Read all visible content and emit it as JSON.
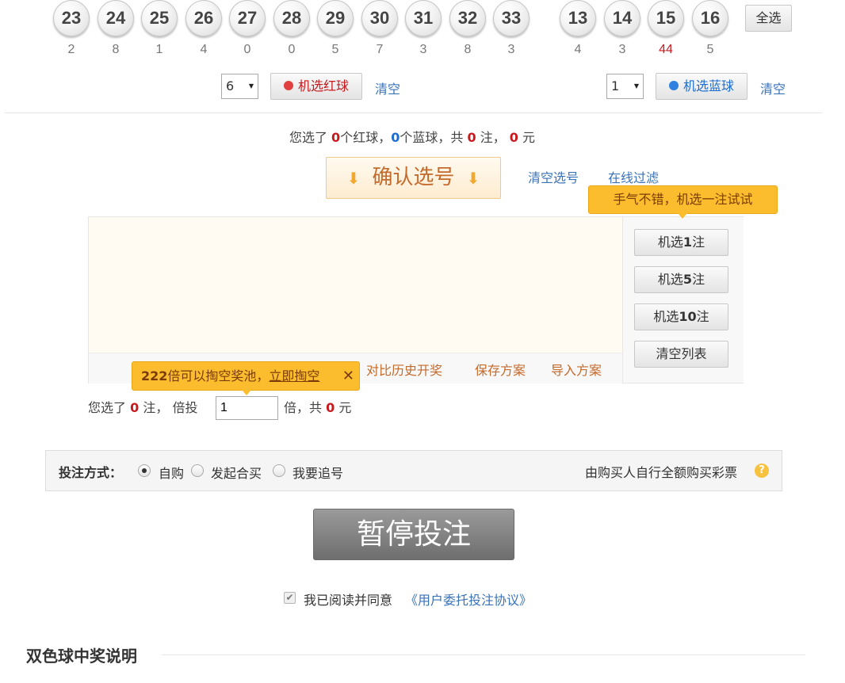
{
  "red_balls": [
    {
      "number": "23",
      "count": "2"
    },
    {
      "number": "24",
      "count": "8"
    },
    {
      "number": "25",
      "count": "1"
    },
    {
      "number": "26",
      "count": "4"
    },
    {
      "number": "27",
      "count": "0"
    },
    {
      "number": "28",
      "count": "0"
    },
    {
      "number": "29",
      "count": "5"
    },
    {
      "number": "30",
      "count": "7"
    },
    {
      "number": "31",
      "count": "3"
    },
    {
      "number": "32",
      "count": "8"
    },
    {
      "number": "33",
      "count": "3"
    }
  ],
  "blue_balls": [
    {
      "number": "13",
      "count": "4"
    },
    {
      "number": "14",
      "count": "3"
    },
    {
      "number": "15",
      "count": "44",
      "hot": true
    },
    {
      "number": "16",
      "count": "5"
    }
  ],
  "select_all_label": "全选",
  "red_random": {
    "count": "6",
    "button_label": "机选红球",
    "clear_label": "清空",
    "icon_color": "#e04040"
  },
  "blue_random": {
    "count": "1",
    "button_label": "机选蓝球",
    "clear_label": "清空",
    "icon_color": "#2f80e0"
  },
  "summary": {
    "prefix": "您选了",
    "red_count": "0",
    "red_unit": "个红球，",
    "blue_count": "0",
    "blue_unit": "个蓝球，共",
    "bets": "0",
    "bets_unit": "注，",
    "amount": "0",
    "amount_unit": "元"
  },
  "confirm_button": {
    "label": "确认选号",
    "arrow": "⬇"
  },
  "clear_selection_label": "清空选号",
  "online_filter_label": "在线过滤",
  "random_tip": "手气不错，机选一注试试",
  "side_buttons": {
    "random1": {
      "pre": "机选",
      "num": "1",
      "post": "注"
    },
    "random5": {
      "pre": "机选",
      "num": "5",
      "post": "注"
    },
    "random10": {
      "pre": "机选",
      "num": "10",
      "post": "注"
    },
    "clear_list": "清空列表"
  },
  "list_actions": {
    "compare_history": "对比历史开奖",
    "save_plan": "保存方案",
    "import_plan": "导入方案"
  },
  "jackpot_tip": {
    "multiple": "222",
    "text": "倍可以掏空奖池，",
    "link": "立即掏空",
    "close": "✕"
  },
  "multiplier_row": {
    "prefix": "您选了",
    "bets": "0",
    "bets_unit": "注，",
    "times_label": "倍投",
    "times_value": "1",
    "times_unit": "倍，共",
    "amount": "0",
    "amount_unit": "元"
  },
  "bet_mode": {
    "label": "投注方式：",
    "options": [
      {
        "label": "自购",
        "selected": true
      },
      {
        "label": "发起合买",
        "selected": false
      },
      {
        "label": "我要追号",
        "selected": false
      }
    ],
    "description": "由购买人自行全额购买彩票",
    "help_icon": "?"
  },
  "submit_button_label": "暂停投注",
  "agreement": {
    "text": "我已阅读并同意",
    "link": "《用户委托投注协议》",
    "checked": true
  },
  "section_title": "双色球中奖说明"
}
